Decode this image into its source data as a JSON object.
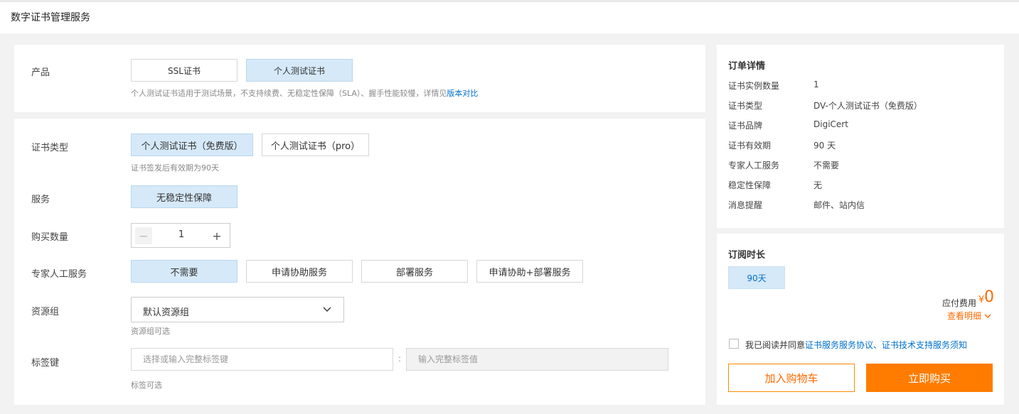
{
  "header": {
    "title": "数字证书管理服务"
  },
  "product": {
    "label": "产品",
    "options": [
      "SSL证书",
      "个人测试证书"
    ],
    "hint": "个人测试证书适用于测试场景，不支持续费、无稳定性保障（SLA）、握手性能较慢，详情见",
    "hint_link": "版本对比"
  },
  "cert_type": {
    "label": "证书类型",
    "options": [
      "个人测试证书（免费版）",
      "个人测试证书（pro）"
    ],
    "hint": "证书签发后有效期为90天"
  },
  "service": {
    "label": "服务",
    "options": [
      "无稳定性保障"
    ]
  },
  "quantity": {
    "label": "购买数量",
    "value": "1",
    "minus": "−",
    "plus": "+"
  },
  "expert": {
    "label": "专家人工服务",
    "options": [
      "不需要",
      "申请协助服务",
      "部署服务",
      "申请协助+部署服务"
    ]
  },
  "resource_group": {
    "label": "资源组",
    "value": "默认资源组",
    "hint": "资源组可选"
  },
  "tags": {
    "label": "标签键",
    "key_placeholder": "选择或输入完整标签键",
    "colon": ":",
    "value_placeholder": "输入完整标签值",
    "hint": "标签可选"
  },
  "order": {
    "title": "订单详情",
    "rows": [
      {
        "k": "证书实例数量",
        "v": "1"
      },
      {
        "k": "证书类型",
        "v": "DV-个人测试证书（免费版）"
      },
      {
        "k": "证书品牌",
        "v": "DigiCert"
      },
      {
        "k": "证书有效期",
        "v": "90 天"
      },
      {
        "k": "专家人工服务",
        "v": "不需要"
      },
      {
        "k": "稳定性保障",
        "v": "无"
      },
      {
        "k": "消息提醒",
        "v": "邮件、站内信"
      }
    ]
  },
  "subscription": {
    "title": "订阅时长",
    "duration": "90天",
    "fee_label": "应付费用",
    "currency": "¥",
    "fee": "0",
    "details_link": "查看明细",
    "agree_text": "我已阅读并同意",
    "agree_link1": "证书服务服务协议",
    "agree_sep": "、",
    "agree_link2": "证书技术支持服务须知",
    "cart_button": "加入购物车",
    "buy_button": "立即购买"
  },
  "colors": {
    "accent": "#ff7c00",
    "link": "#0070cc",
    "selected_bg": "#d6e9f8"
  }
}
